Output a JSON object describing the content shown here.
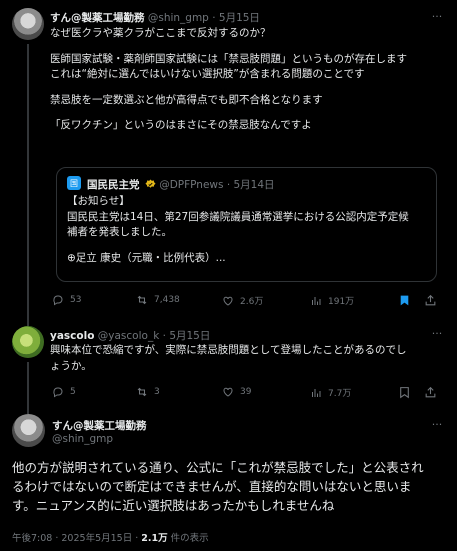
{
  "tweet1": {
    "name": "すん@製薬工場勤務",
    "handle": "@shin_gmp",
    "sep": "·",
    "date": "5月15日",
    "lines": [
      "なぜ医クラや薬クラがここまで反対するのか？",
      "医師国家試験・薬剤師国家試験には「禁忌肢問題」というものが存在します",
      "これは“絶対に選んではいけない選択肢”が含まれる問題のことです",
      "禁忌肢を一定数選ぶと他が高得点でも即不合格となります",
      "「反ワクチン」というのはまさにその禁忌肢なんですよ"
    ],
    "quote": {
      "name": "国民民主党",
      "handle": "@DPFPnews",
      "sep": "·",
      "date": "5月14日",
      "lines": [
        "【お知らせ】",
        "国民民主党は14日、第27回参議院議員通常選挙における公認内定予定候",
        "補者を発表しました。",
        "⊕足立 康史（元職・比例代表）..."
      ]
    },
    "actions": {
      "replies": "53",
      "reposts": "7,438",
      "likes": "2.6万",
      "views": "191万"
    }
  },
  "tweet2": {
    "name": "yascolo",
    "handle": "@yascolo_k",
    "sep": "·",
    "date": "5月15日",
    "lines": [
      "興味本位で恐縮ですが、実際に禁忌肢問題として登場したことがあるのでし",
      "ょうか。"
    ],
    "actions": {
      "replies": "5",
      "reposts": "3",
      "likes": "39",
      "views": "7.7万"
    }
  },
  "tweet3": {
    "name": "すん@製薬工場勤務",
    "handle": "@shin_gmp",
    "lines": [
      "他の方が説明されている通り、公式に「これが禁忌肢でした」と公表され",
      "るわけではないので断定はできませんが、直接的な問いはないと思いま",
      "す。ニュアンス的に近い選択肢はあったかもしれませんね"
    ],
    "footer": {
      "time": "午後7:08 · 2025年5月15日 · ",
      "views": "2.1万",
      "views_suffix": " 件の表示"
    }
  },
  "colors": {
    "background": "#000000",
    "text": "#e7e9ea",
    "muted": "#71767b",
    "accent": "#1d9bf0",
    "border": "#2f3336"
  }
}
